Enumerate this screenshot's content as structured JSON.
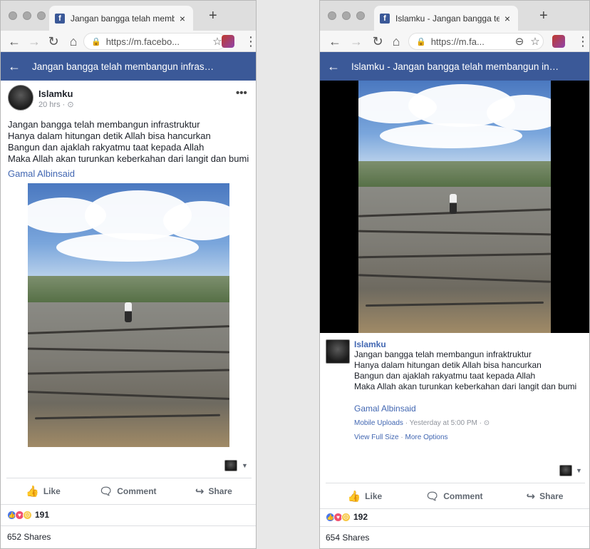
{
  "left": {
    "tab": {
      "favicon": "f",
      "title": "Jangan bangga telah membang",
      "close": "×",
      "new": "+"
    },
    "toolbar": {
      "back": "←",
      "forward": "→",
      "reload": "↻",
      "home": "⌂",
      "lock": "🔒",
      "url": "https://m.facebo...",
      "star": "☆",
      "menu": "⋮"
    },
    "fbbar": {
      "back": "←",
      "title": "Jangan bangga telah membangun infras…"
    },
    "post": {
      "name": "Islamku",
      "time": "20 hrs · ⊙",
      "more": "•••",
      "lines": [
        "Jangan bangga telah membangun infrastruktur",
        "Hanya dalam hitungan detik Allah bisa hancurkan",
        "Bangun dan ajaklah rakyatmu taat kepada Allah",
        "Maka Allah akan turunkan keberkahan dari langit dan bumi"
      ],
      "author": "Gamal Albinsaid"
    },
    "reactions": {
      "count": "191"
    },
    "actions": {
      "like": "Like",
      "comment": "Comment",
      "share": "Share"
    },
    "shares": "652 Shares"
  },
  "right": {
    "tab": {
      "favicon": "f",
      "title": "Islamku - Jangan bangga telah",
      "close": "×",
      "new": "+"
    },
    "toolbar": {
      "back": "←",
      "forward": "→",
      "reload": "↻",
      "lock": "🔒",
      "url": "https://m.fa...",
      "zoom": "⊖",
      "star": "☆",
      "menu": "⋮"
    },
    "fbbar": {
      "back": "←",
      "title": "Islamku - Jangan bangga telah membangun in…"
    },
    "post": {
      "name": "Islamku",
      "lines": [
        "Jangan bangga telah membangun infraktruktur",
        "Hanya dalam hitungan detik Allah bisa hancurkan",
        "Bangun dan ajaklah rakyatmu taat kepada Allah",
        "Maka Allah akan turunkan keberkahan dari langit dan bumi"
      ],
      "author": "Gamal Albinsaid",
      "meta_album": "Mobile Uploads",
      "meta_time": " · Yesterday at 5:00 PM · ⊙",
      "view_full": "View Full Size",
      "sep": " · ",
      "more_options": "More Options"
    },
    "reactions": {
      "count": "192"
    },
    "actions": {
      "like": "Like",
      "comment": "Comment",
      "share": "Share"
    },
    "shares": "654 Shares"
  },
  "colors": {
    "facebook_blue": "#3b5998",
    "link_blue": "#4267b2",
    "like": "#4a76e8",
    "love": "#f0506e",
    "sad": "#f7c743"
  },
  "icons": [
    "facebook-favicon",
    "lock-icon",
    "star-icon",
    "kebab-menu-icon",
    "back-arrow-icon",
    "like-thumb-icon",
    "comment-bubble-icon",
    "share-arrow-icon",
    "globe-icon",
    "zoom-out-icon"
  ]
}
